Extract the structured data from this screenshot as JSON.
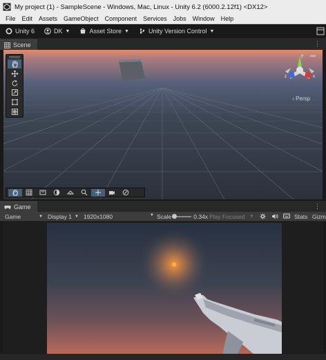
{
  "window": {
    "title": "My project (1) - SampleScene - Windows, Mac, Linux - Unity 6.2 (6000.2.12f1) <DX12>"
  },
  "menu": [
    "File",
    "Edit",
    "Assets",
    "GameObject",
    "Component",
    "Services",
    "Jobs",
    "Window",
    "Help"
  ],
  "toolbar": {
    "unity_label": "Unity 6",
    "account_label": "DK",
    "asset_store_label": "Asset Store",
    "version_control_label": "Unity Version Control"
  },
  "scene": {
    "tab_label": "Scene",
    "projection_label": "‹ Persp",
    "colors": {
      "horizon": "#e58a6a",
      "sky": "#3d4654",
      "ground": "#2c313b",
      "grid": "#707784"
    }
  },
  "game": {
    "tab_label": "Game",
    "mode_label": "Game",
    "display_label": "Display 1",
    "resolution_label": "1920x1080",
    "scale_label": "Scale",
    "scale_value": "0.34x",
    "play_focused_label": "Play Focused",
    "stats_label": "Stats",
    "gizmos_label": "Gizm",
    "colors": {
      "sky_top": "#283140",
      "sky_bottom": "#b86a5a",
      "sun": "#ff9b3a"
    }
  },
  "icons": {
    "tools": [
      "hand-icon",
      "move-icon",
      "rotate-icon",
      "scale-icon",
      "rect-icon",
      "transform-icon"
    ],
    "overlay": [
      "hand-icon",
      "grid-icon",
      "view-icon",
      "shading-icon",
      "render-icon",
      "search-icon",
      "move-icon",
      "camera-icon",
      "gizmo-icon"
    ]
  }
}
